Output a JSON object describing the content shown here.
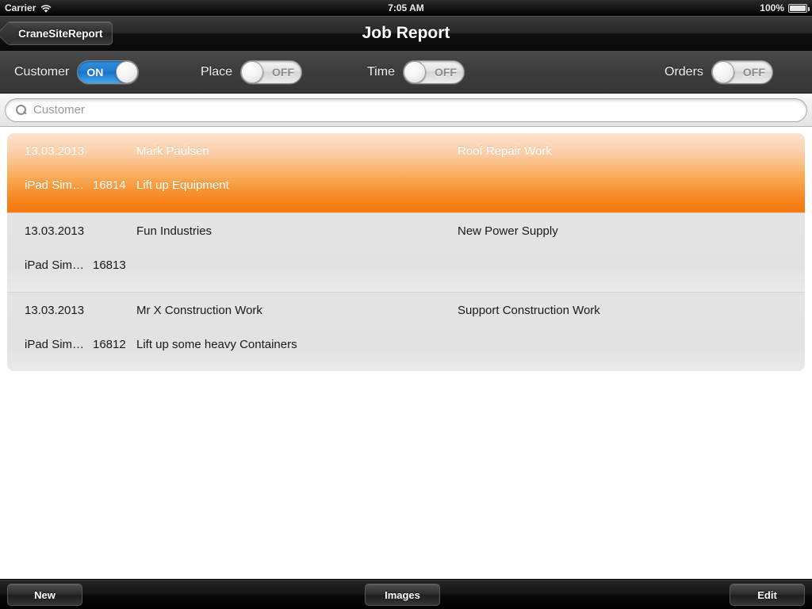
{
  "status_bar": {
    "carrier": "Carrier",
    "wifi_icon": "wifi-icon",
    "time": "7:05 AM",
    "battery_percent": "100%",
    "battery_icon": "battery-icon"
  },
  "nav_bar": {
    "back_label": "CraneSiteReport",
    "title": "Job Report"
  },
  "filter_bar": {
    "filters": [
      {
        "label": "Customer",
        "state": "ON",
        "on": true
      },
      {
        "label": "Place",
        "state": "OFF",
        "on": false
      },
      {
        "label": "Time",
        "state": "OFF",
        "on": false
      },
      {
        "label": "Orders",
        "state": "OFF",
        "on": false
      }
    ]
  },
  "search": {
    "placeholder": "Customer",
    "value": "",
    "icon": "search-icon"
  },
  "list": {
    "rows": [
      {
        "date": "13.03.2013",
        "customer": "Mark Paulsen",
        "work": "Roof Repair Work",
        "device": "iPad Sim…",
        "id": "16814",
        "description": "Lift up Equipment",
        "selected": true
      },
      {
        "date": "13.03.2013",
        "customer": "Fun Industries",
        "work": "New Power Supply",
        "device": "iPad Sim…",
        "id": "16813",
        "description": "",
        "selected": false
      },
      {
        "date": "13.03.2013",
        "customer": "Mr X Construction Work",
        "work": "Support Construction Work",
        "device": "iPad Sim…",
        "id": "16812",
        "description": "Lift up some heavy Containers",
        "selected": false
      }
    ]
  },
  "toolbar": {
    "new_label": "New",
    "images_label": "Images",
    "edit_label": "Edit"
  },
  "colors": {
    "accent_orange": "#f47c12",
    "switch_on_blue": "#1f7ed3",
    "row_background": "#e4e4e4",
    "chrome_dark": "#1a1a1a"
  }
}
